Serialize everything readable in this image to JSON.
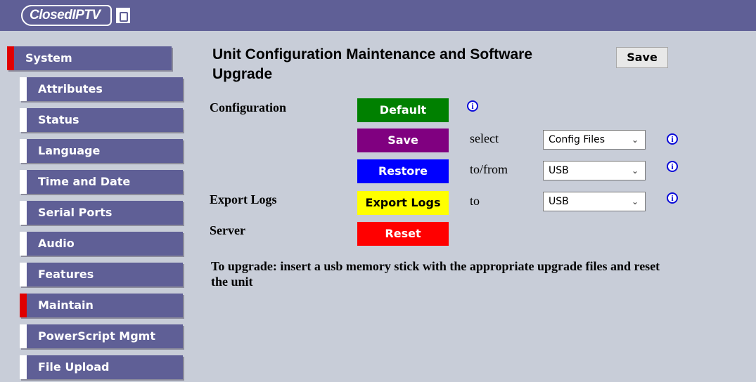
{
  "header": {
    "logo_text_closed": "Closed",
    "logo_text_iptv": "IPTV",
    "lock_icon": "lock-icon",
    "bg_color": "#5f5f96"
  },
  "sidebar": {
    "items": [
      {
        "label": "System",
        "state": "section"
      },
      {
        "label": "Attributes"
      },
      {
        "label": "Status"
      },
      {
        "label": "Language"
      },
      {
        "label": "Time and Date"
      },
      {
        "label": "Serial Ports"
      },
      {
        "label": "Audio"
      },
      {
        "label": "Features"
      },
      {
        "label": "Maintain",
        "state": "active"
      },
      {
        "label": "PowerScript Mgmt"
      },
      {
        "label": "File Upload"
      }
    ],
    "active_marker_color": "#e00000"
  },
  "main": {
    "title": "Unit Configuration Maintenance and Software Upgrade",
    "save_label": "Save",
    "rows": {
      "configuration_label": "Configuration",
      "export_logs_label": "Export Logs",
      "server_label": "Server"
    },
    "buttons": {
      "default": {
        "label": "Default",
        "color": "#008000"
      },
      "save": {
        "label": "Save",
        "color": "#800080"
      },
      "restore": {
        "label": "Restore",
        "color": "#0000ff"
      },
      "export_logs": {
        "label": "Export Logs",
        "color": "#ffff00"
      },
      "reset": {
        "label": "Reset",
        "color": "#ff0000"
      }
    },
    "text": {
      "select": "select",
      "to_from": "to/from",
      "to": "to"
    },
    "selects": {
      "save_source": "Config Files",
      "restore_target": "USB",
      "export_target": "USB"
    },
    "info_icon": "info-icon",
    "upgrade_note": "To upgrade: insert a usb memory stick with the appropriate upgrade files and reset the unit"
  }
}
